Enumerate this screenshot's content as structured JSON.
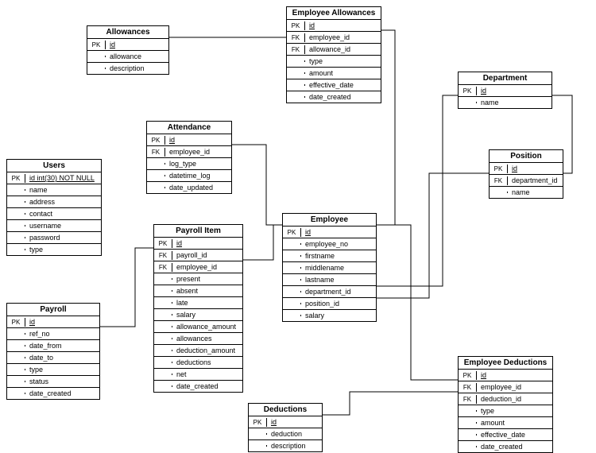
{
  "entities": {
    "allowances": {
      "title": "Allowances",
      "rows": [
        {
          "key": "PK",
          "field": "id",
          "pk": true
        },
        {
          "key": "",
          "field": "allowance"
        },
        {
          "key": "",
          "field": "description"
        }
      ]
    },
    "employee_allowances": {
      "title": "Employee Allowances",
      "rows": [
        {
          "key": "PK",
          "field": "id",
          "pk": true
        },
        {
          "key": "FK",
          "field": "employee_id"
        },
        {
          "key": "FK",
          "field": "allowance_id"
        },
        {
          "key": "",
          "field": "type"
        },
        {
          "key": "",
          "field": "amount"
        },
        {
          "key": "",
          "field": "effective_date"
        },
        {
          "key": "",
          "field": "date_created"
        }
      ]
    },
    "department": {
      "title": "Department",
      "rows": [
        {
          "key": "PK",
          "field": "id",
          "pk": true
        },
        {
          "key": "",
          "field": "name"
        }
      ]
    },
    "attendance": {
      "title": "Attendance",
      "rows": [
        {
          "key": "PK",
          "field": "id",
          "pk": true
        },
        {
          "key": "FK",
          "field": "employee_id"
        },
        {
          "key": "",
          "field": "log_type"
        },
        {
          "key": "",
          "field": "datetime_log"
        },
        {
          "key": "",
          "field": "date_updated"
        }
      ]
    },
    "users": {
      "title": "Users",
      "rows": [
        {
          "key": "PK",
          "field": "id int(30) NOT NULL",
          "pk": true
        },
        {
          "key": "",
          "field": "name"
        },
        {
          "key": "",
          "field": "address"
        },
        {
          "key": "",
          "field": "contact"
        },
        {
          "key": "",
          "field": "username"
        },
        {
          "key": "",
          "field": "password"
        },
        {
          "key": "",
          "field": "type"
        }
      ]
    },
    "position": {
      "title": "Position",
      "rows": [
        {
          "key": "PK",
          "field": "id",
          "pk": true
        },
        {
          "key": "FK",
          "field": "department_id"
        },
        {
          "key": "",
          "field": "name"
        }
      ]
    },
    "payroll_item": {
      "title": "Payroll Item",
      "rows": [
        {
          "key": "PK",
          "field": "id",
          "pk": true
        },
        {
          "key": "FK",
          "field": "payroll_id"
        },
        {
          "key": "FK",
          "field": "employee_id"
        },
        {
          "key": "",
          "field": "present"
        },
        {
          "key": "",
          "field": "absent"
        },
        {
          "key": "",
          "field": "late"
        },
        {
          "key": "",
          "field": "salary"
        },
        {
          "key": "",
          "field": "allowance_amount"
        },
        {
          "key": "",
          "field": "allowances"
        },
        {
          "key": "",
          "field": "deduction_amount"
        },
        {
          "key": "",
          "field": "deductions"
        },
        {
          "key": "",
          "field": "net"
        },
        {
          "key": "",
          "field": "date_created"
        }
      ]
    },
    "employee": {
      "title": "Employee",
      "rows": [
        {
          "key": "PK",
          "field": "id",
          "pk": true
        },
        {
          "key": "",
          "field": "employee_no"
        },
        {
          "key": "",
          "field": "firstname"
        },
        {
          "key": "",
          "field": "middlename"
        },
        {
          "key": "",
          "field": "lastname"
        },
        {
          "key": "",
          "field": "department_id"
        },
        {
          "key": "",
          "field": "position_id"
        },
        {
          "key": "",
          "field": "salary"
        }
      ]
    },
    "payroll": {
      "title": "Payroll",
      "rows": [
        {
          "key": "PK",
          "field": "id",
          "pk": true
        },
        {
          "key": "",
          "field": "ref_no"
        },
        {
          "key": "",
          "field": "date_from"
        },
        {
          "key": "",
          "field": "date_to"
        },
        {
          "key": "",
          "field": "type"
        },
        {
          "key": "",
          "field": "status"
        },
        {
          "key": "",
          "field": "date_created"
        }
      ]
    },
    "employee_deductions": {
      "title": "Employee Deductions",
      "rows": [
        {
          "key": "PK",
          "field": "id",
          "pk": true
        },
        {
          "key": "FK",
          "field": "employee_id"
        },
        {
          "key": "FK",
          "field": "deduction_id"
        },
        {
          "key": "",
          "field": "type"
        },
        {
          "key": "",
          "field": "amount"
        },
        {
          "key": "",
          "field": "effective_date"
        },
        {
          "key": "",
          "field": "date_created"
        }
      ]
    },
    "deductions": {
      "title": "Deductions",
      "rows": [
        {
          "key": "PK",
          "field": "id",
          "pk": true
        },
        {
          "key": "",
          "field": "deduction"
        },
        {
          "key": "",
          "field": "description"
        }
      ]
    }
  },
  "relationships": [
    {
      "from": "allowances",
      "to": "employee_allowances",
      "via": "allowance_id"
    },
    {
      "from": "employee",
      "to": "employee_allowances",
      "via": "employee_id"
    },
    {
      "from": "employee",
      "to": "attendance",
      "via": "employee_id"
    },
    {
      "from": "employee",
      "to": "payroll_item",
      "via": "employee_id"
    },
    {
      "from": "employee",
      "to": "employee_deductions",
      "via": "employee_id"
    },
    {
      "from": "payroll",
      "to": "payroll_item",
      "via": "payroll_id"
    },
    {
      "from": "department",
      "to": "employee",
      "via": "department_id"
    },
    {
      "from": "department",
      "to": "position",
      "via": "department_id"
    },
    {
      "from": "position",
      "to": "employee",
      "via": "position_id"
    },
    {
      "from": "deductions",
      "to": "employee_deductions",
      "via": "deduction_id"
    }
  ]
}
